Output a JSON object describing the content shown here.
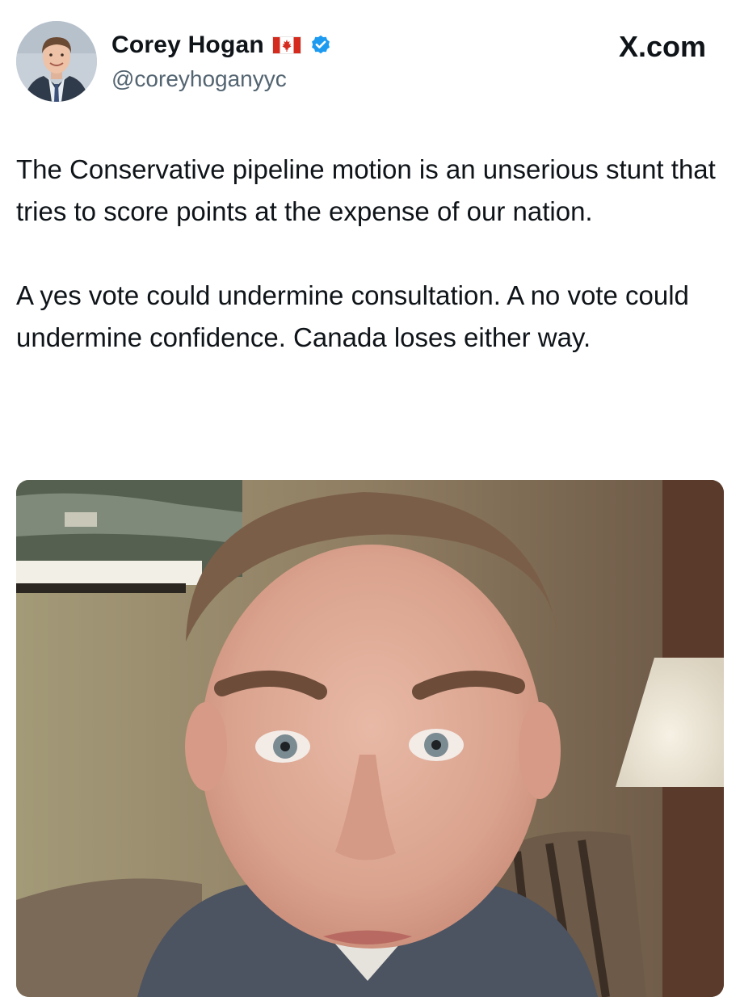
{
  "author": {
    "display_name": "Corey Hogan",
    "flag_icon": "canada-flag-icon",
    "verified_icon": "verified-badge-icon",
    "verified_color": "#1d9bf0",
    "handle": "@coreyhoganyyc"
  },
  "brand": {
    "label": "X.com",
    "icon": "x-logo-icon"
  },
  "tweet": {
    "paragraphs": [
      "The Conservative pipeline motion is an unserious stunt that tries to score points at the expense of our nation.",
      "A yes vote could undermine consultation. A no vote could undermine confidence. Canada loses either way."
    ]
  },
  "media": {
    "type": "video-thumbnail"
  },
  "colors": {
    "text_primary": "#0f1419",
    "text_secondary": "#536471",
    "flag_red": "#d52b1e"
  }
}
